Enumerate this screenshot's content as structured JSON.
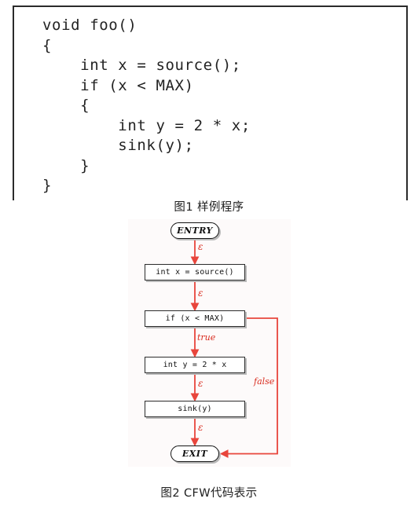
{
  "figure1": {
    "code": "void foo()\n{\n    int x = source();\n    if (x < MAX)\n    {\n        int y = 2 * x;\n        sink(y);\n    }\n}",
    "caption": "图1 样例程序"
  },
  "figure2": {
    "caption": "图2 CFW代码表示",
    "graph": {
      "nodes": [
        {
          "id": "entry",
          "label": "ENTRY",
          "shape": "stadium"
        },
        {
          "id": "source",
          "label": "int x = source()",
          "shape": "rect"
        },
        {
          "id": "if",
          "label": "if (x < MAX)",
          "shape": "rect"
        },
        {
          "id": "assign",
          "label": "int y = 2 * x",
          "shape": "rect"
        },
        {
          "id": "sink",
          "label": "sink(y)",
          "shape": "rect"
        },
        {
          "id": "exit",
          "label": "EXIT",
          "shape": "stadium"
        }
      ],
      "edges": [
        {
          "from": "entry",
          "to": "source",
          "label": "ε"
        },
        {
          "from": "source",
          "to": "if",
          "label": "ε"
        },
        {
          "from": "if",
          "to": "assign",
          "label": "true"
        },
        {
          "from": "assign",
          "to": "sink",
          "label": "ε"
        },
        {
          "from": "sink",
          "to": "exit",
          "label": "ε"
        },
        {
          "from": "if",
          "to": "exit",
          "label": "false"
        }
      ],
      "edge_color": "#e8453c",
      "node_border_color": "#2c2c2c",
      "panel_background": "#fdfafa"
    }
  }
}
